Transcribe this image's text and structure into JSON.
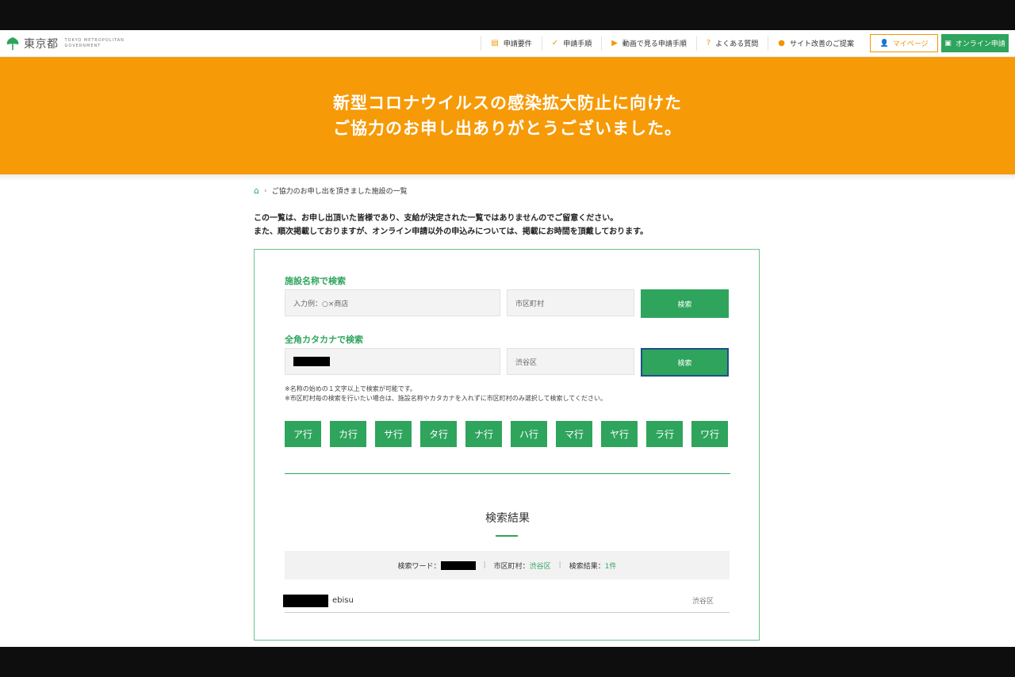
{
  "header": {
    "logo_text": "東京都",
    "logo_sub_line1": "TOKYO METROPOLITAN",
    "logo_sub_line2": "GOVERNMENT",
    "nav": [
      {
        "label": "申請要件",
        "icon": "document-icon"
      },
      {
        "label": "申請手順",
        "icon": "check-icon"
      },
      {
        "label": "動画で見る申請手順",
        "icon": "video-icon"
      },
      {
        "label": "よくある質問",
        "icon": "question-icon"
      },
      {
        "label": "サイト改善のご提案",
        "icon": "chat-icon"
      }
    ],
    "mypage_label": "マイページ",
    "online_label": "オンライン申請"
  },
  "hero": {
    "line1": "新型コロナウイルスの感染拡大防止に向けた",
    "line2": "ご協力のお申し出ありがとうございました。"
  },
  "breadcrumb": {
    "current": "ご協力のお申し出を頂きました施設の一覧"
  },
  "notice": {
    "line1": "この一覧は、お申し出頂いた皆様であり、支給が決定された一覧ではありませんのでご留意ください。",
    "line2": "また、順次掲載しておりますが、オンライン申請以外の申込みについては、掲載にお時間を頂戴しております。"
  },
  "search_name": {
    "label": "施設名称で検索",
    "placeholder": "入力例：○×商店",
    "ward_placeholder": "市区町村",
    "button": "検索"
  },
  "search_kana": {
    "label": "全角カタカナで検索",
    "ward_value": "渋谷区",
    "button": "検索"
  },
  "notes": {
    "line1": "※名称の始めの１文字以上で検索が可能です。",
    "line2": "※市区町村毎の検索を行いたい場合は、施設名称やカタカナを入れずに市区町村のみ選択して検索してください。"
  },
  "kana_buttons": [
    "ア行",
    "カ行",
    "サ行",
    "タ行",
    "ナ行",
    "ハ行",
    "マ行",
    "ヤ行",
    "ラ行",
    "ワ行"
  ],
  "results": {
    "title": "検索結果",
    "word_label": "検索ワード：",
    "ward_label": "市区町村：",
    "ward_value": "渋谷区",
    "count_label": "検索結果：",
    "count_value": "1件",
    "items": [
      {
        "name_suffix": "ebisu",
        "ward": "渋谷区"
      }
    ]
  },
  "colors": {
    "brand_green": "#2ea45c",
    "hero_orange": "#f69a07",
    "accent_orange": "#f29600"
  }
}
